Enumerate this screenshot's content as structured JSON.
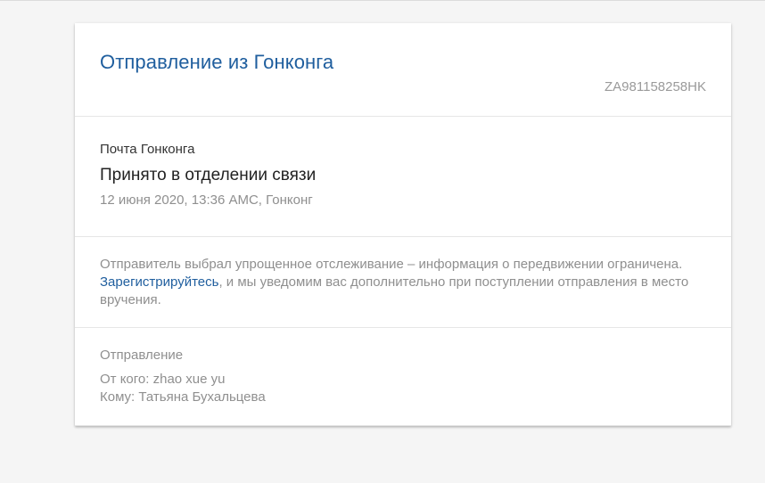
{
  "shipment": {
    "title": "Отправление из Гонконга",
    "tracking_number": "ZA981158258HK"
  },
  "status": {
    "operator": "Почта Гонконга",
    "title": "Принято в отделении связи",
    "datetime": "12 июня 2020, 13:36 AMC, Гонконг"
  },
  "notice": {
    "text_before": "Отправитель выбрал упрощенное отслеживание – информация о передвижении ограничена. ",
    "link_text": "Зарегистрируйтесь",
    "text_after": ", и мы уведомим вас дополнительно при поступлении отправления в место вручения."
  },
  "parties": {
    "heading": "Отправление",
    "from_label": "От кого: ",
    "from_value": "zhao xue yu",
    "to_label": "Кому: ",
    "to_value": "Татьяна Бухальцева"
  },
  "colors": {
    "accent": "#1f5e9e",
    "muted_text": "#8f8f8f",
    "background": "#f5f5f5"
  }
}
